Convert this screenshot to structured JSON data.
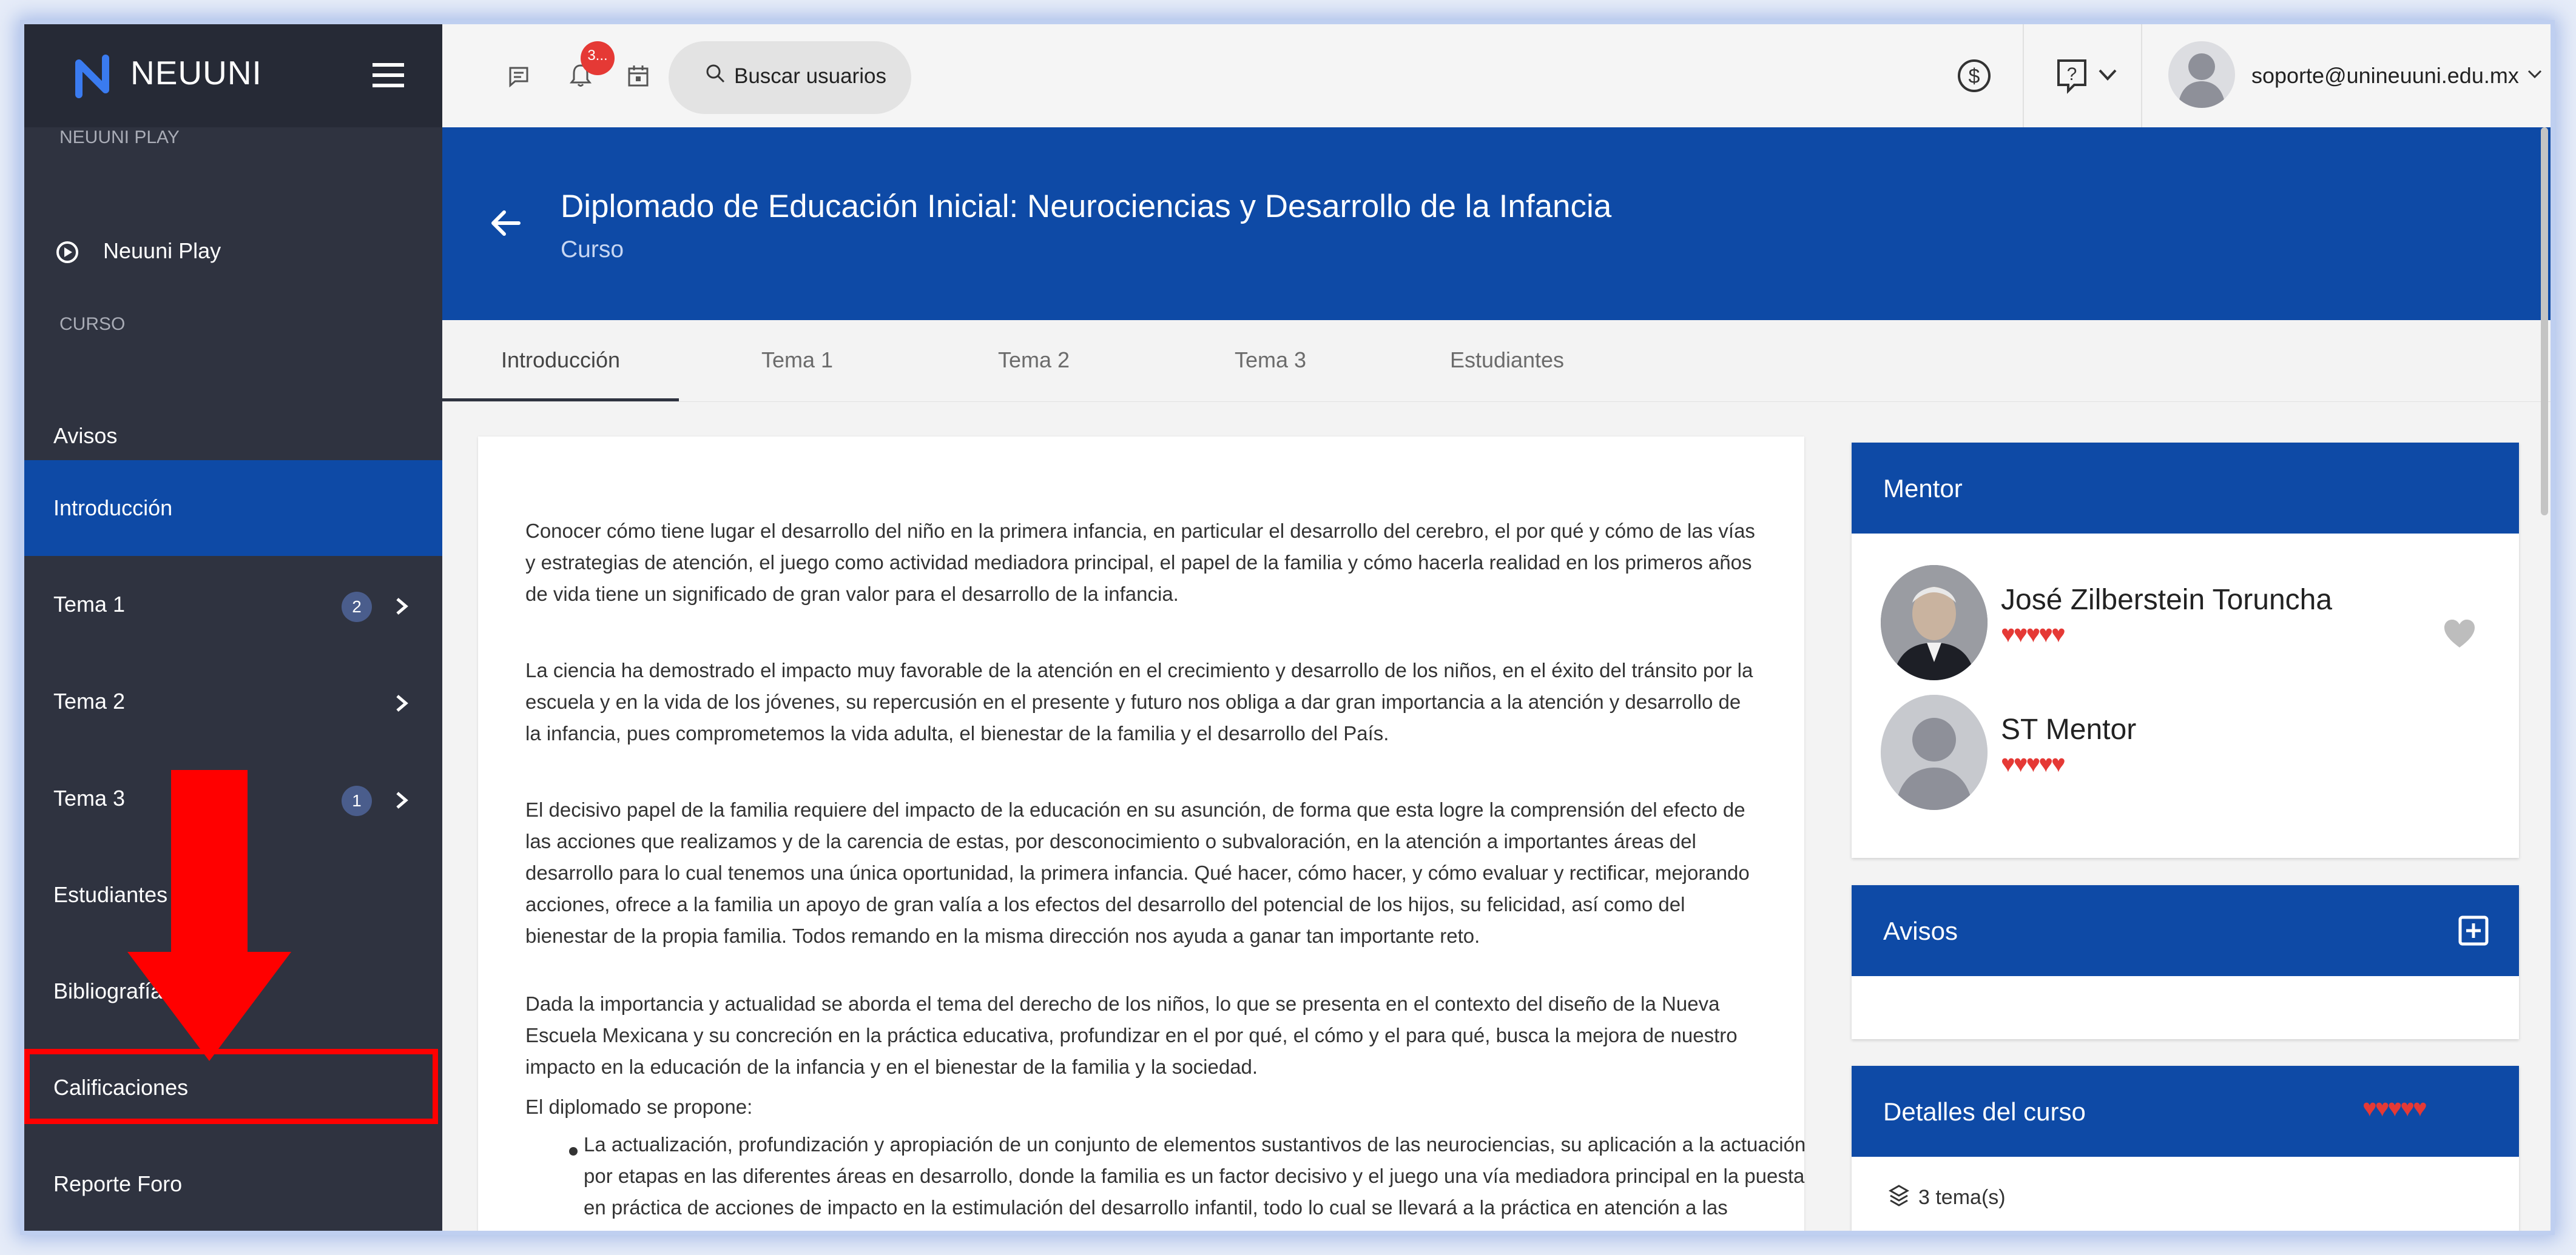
{
  "brand": {
    "name": "NEUUNI"
  },
  "sidebar": {
    "sections": [
      {
        "label": "NEUUNI PLAY"
      },
      {
        "label": "CURSO"
      }
    ],
    "play_item": {
      "label": "Neuuni Play",
      "icon": "play-circle-icon"
    },
    "items": [
      {
        "label": "Avisos"
      },
      {
        "label": "Introducción",
        "active": true
      },
      {
        "label": "Tema 1",
        "badge": "2"
      },
      {
        "label": "Tema 2"
      },
      {
        "label": "Tema 3",
        "badge": "1"
      },
      {
        "label": "Estudiantes"
      },
      {
        "label": "Bibliografía"
      },
      {
        "label": "Calificaciones",
        "highlighted": true
      },
      {
        "label": "Reporte Foro"
      }
    ]
  },
  "topbar": {
    "notif_count": "3...",
    "search_placeholder": "Buscar usuarios",
    "user_email": "soporte@unineuuni.edu.mx",
    "icons": [
      "chat-icon",
      "bell-icon",
      "calendar-icon",
      "search-icon",
      "dollar-icon",
      "help-icon",
      "avatar-icon"
    ]
  },
  "course": {
    "title": "Diplomado de Educación Inicial: Neurociencias y Desarrollo de la Infancia",
    "subtitle": "Curso"
  },
  "tabs": [
    {
      "label": "Introducción",
      "active": true
    },
    {
      "label": "Tema 1"
    },
    {
      "label": "Tema 2"
    },
    {
      "label": "Tema 3"
    },
    {
      "label": "Estudiantes"
    }
  ],
  "article": {
    "paragraphs": [
      "Conocer cómo tiene lugar el desarrollo del niño en la primera infancia, en particular el desarrollo del cerebro, el por qué y cómo de las vías y estrategias de atención, el juego como actividad mediadora principal, el papel de la familia y cómo hacerla realidad en los primeros años de vida tiene un significado de gran valor para el desarrollo de la infancia.",
      "La ciencia ha demostrado el impacto muy favorable de la atención en el crecimiento y desarrollo de los niños, en el éxito del tránsito por la escuela y en la vida de los jóvenes, su repercusión en el presente y futuro nos obliga a dar gran importancia a la atención y desarrollo de la infancia, pues comprometemos la vida adulta, el bienestar de la familia y el desarrollo del País.",
      "El decisivo papel de la familia requiere del impacto de la educación en su asunción, de forma que esta logre la comprensión del efecto de las acciones que realizamos y de la carencia de estas, por desconocimiento o subvaloración, en la atención a importantes áreas del desarrollo para lo cual tenemos una única oportunidad, la primera infancia. Qué hacer, cómo hacer, y cómo evaluar y rectificar, mejorando acciones, ofrece a la familia un apoyo de gran valía a los efectos del desarrollo del potencial de los hijos, su felicidad, así como del bienestar de la propia familia. Todos remando en la misma dirección nos ayuda a ganar tan importante reto.",
      "Dada la importancia y actualidad se aborda el tema del derecho de los niños, lo que se presenta en el contexto del diseño de la Nueva Escuela Mexicana y su concreción en la práctica educativa, profundizar en el por qué, el cómo y el para qué, busca la mejora de nuestro impacto en la educación de la infancia y en el bienestar de la familia y la sociedad.",
      "El diplomado se propone:"
    ],
    "bullet": "La actualización, profundización y apropiación de un conjunto de elementos sustantivos de las neurociencias, su aplicación a la actuación por etapas en las diferentes áreas en desarrollo, donde la familia es un factor decisivo y el juego una vía mediadora principal en la puesta en práctica de acciones de impacto en la estimulación del desarrollo infantil, todo lo cual se llevará a la práctica en atención a las necesidades del contexto social donde"
  },
  "mentor_card": {
    "title": "Mentor",
    "mentors": [
      {
        "name": "José Zilberstein Toruncha",
        "hearts": "♥♥♥♥♥",
        "rating": 5
      },
      {
        "name": "ST Mentor",
        "hearts": "♥♥♥♥♥",
        "rating": 5
      }
    ]
  },
  "avisos_card": {
    "title": "Avisos"
  },
  "details_card": {
    "title": "Detalles del curso",
    "hearts": "♥♥♥♥♥",
    "rating": 5,
    "topics": "3 tema(s)"
  },
  "colors": {
    "primary": "#0e4aa6",
    "sidebar": "#2f3340",
    "heart": "#e53935",
    "annotation": "#ff0000"
  }
}
